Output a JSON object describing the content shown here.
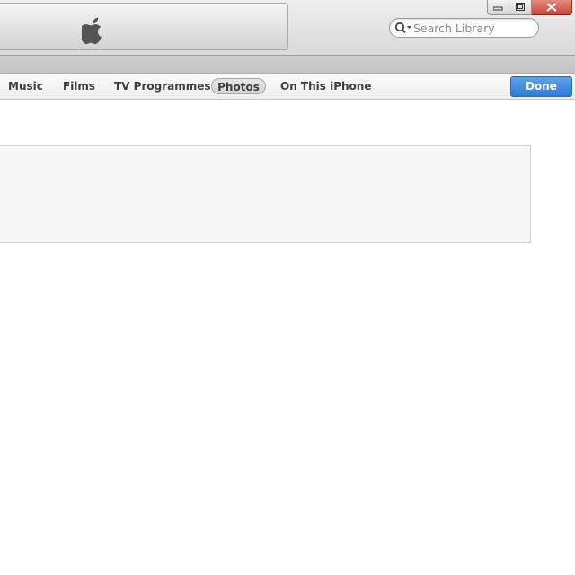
{
  "window": {
    "controls": {
      "minimize_icon": "minimize-icon",
      "maximize_icon": "maximize-icon",
      "close_icon": "close-icon"
    }
  },
  "header": {
    "logo_icon": "apple-logo-icon"
  },
  "search": {
    "placeholder": "Search Library",
    "value": ""
  },
  "nav": {
    "tabs": [
      {
        "label": "Music",
        "selected": false
      },
      {
        "label": "Films",
        "selected": false
      },
      {
        "label": "TV Programmes",
        "selected": false
      },
      {
        "label": "Photos",
        "selected": true
      },
      {
        "label": "On This iPhone",
        "selected": false
      }
    ],
    "done_label": "Done"
  },
  "colors": {
    "accent_button": "#3a86dc",
    "close_button": "#d0584a",
    "selected_tab": "#dcdcdc"
  }
}
